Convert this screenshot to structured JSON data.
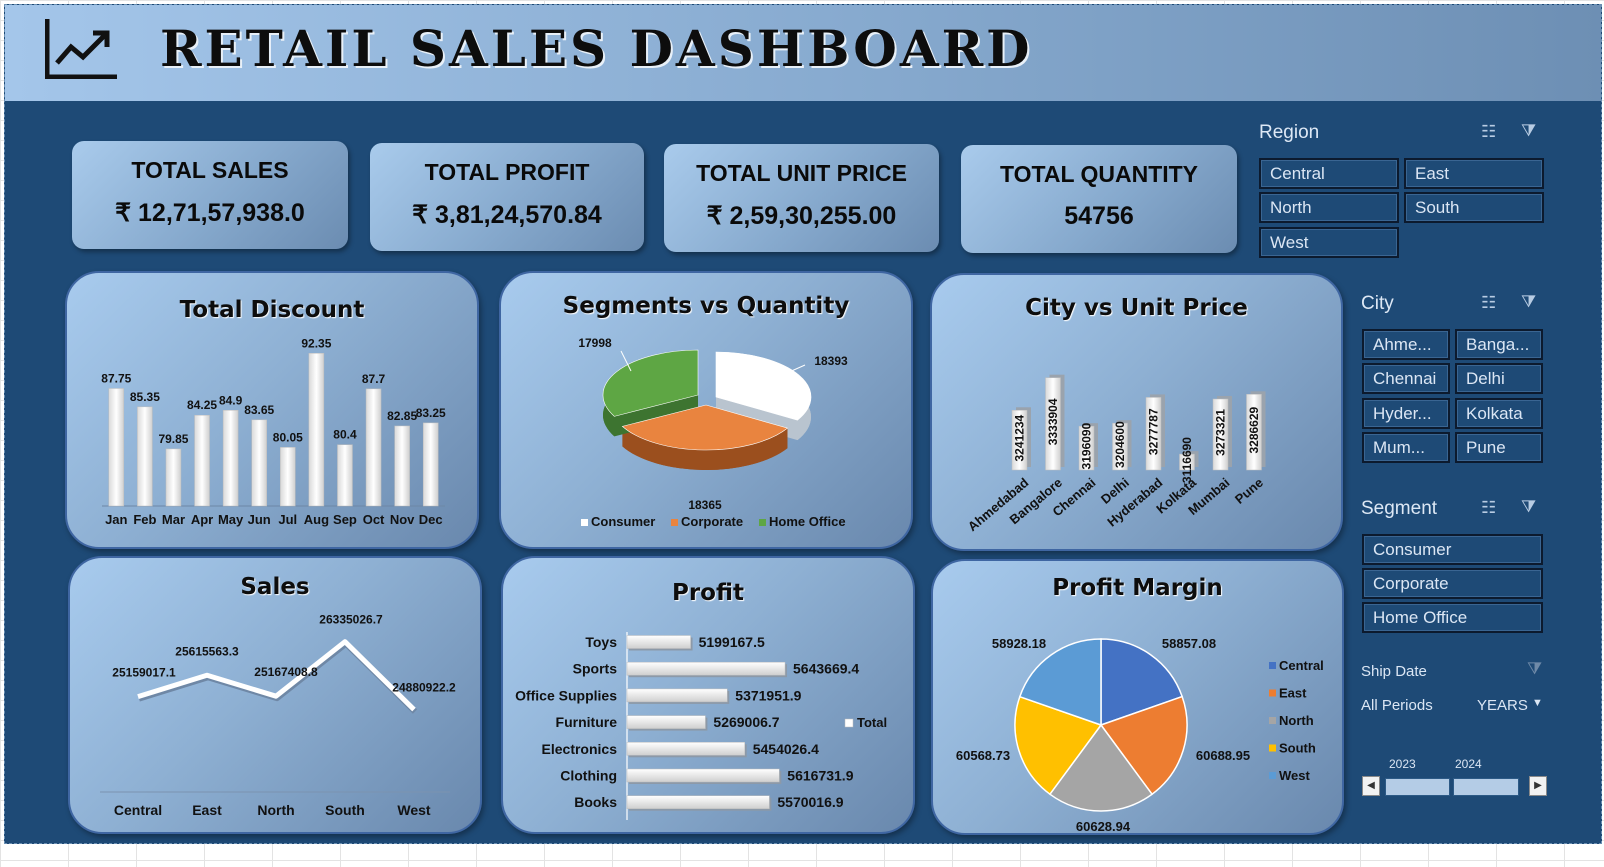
{
  "header": {
    "title": "RETAIL SALES DASHBOARD"
  },
  "kpis": [
    {
      "label": "TOTAL SALES",
      "value": "₹ 12,71,57,938.0"
    },
    {
      "label": "TOTAL PROFIT",
      "value": "₹ 3,81,24,570.84"
    },
    {
      "label": "TOTAL UNIT PRICE",
      "value": "₹ 2,59,30,255.00"
    },
    {
      "label": "TOTAL QUANTITY",
      "value": "54756"
    }
  ],
  "slicers": {
    "region": {
      "title": "Region",
      "items": [
        "Central",
        "East",
        "North",
        "South",
        "West"
      ]
    },
    "city": {
      "title": "City",
      "items": [
        "Ahme...",
        "Banga...",
        "Chennai",
        "Delhi",
        "Hyder...",
        "Kolkata",
        "Mum...",
        "Pune"
      ]
    },
    "segment": {
      "title": "Segment",
      "items": [
        "Consumer",
        "Corporate",
        "Home Office"
      ]
    },
    "timeline": {
      "title": "Ship Date",
      "period": "All Periods",
      "level": "YEARS",
      "years": [
        "2023",
        "2024"
      ]
    }
  },
  "colors": {
    "background": "#1e4a76",
    "accent": "#3f66a2",
    "pie_blue": "#4472c4",
    "pie_orange": "#ed7d31",
    "pie_gray": "#a5a5a5",
    "pie_yellow": "#ffc000",
    "pie_lightblue": "#5b9bd5"
  },
  "icons": [
    "chart-trend-icon",
    "multi-select-icon",
    "clear-filter-icon",
    "dropdown-arrow-icon",
    "scroll-left-icon",
    "scroll-right-icon"
  ],
  "chart_data": [
    {
      "type": "bar",
      "title": "Total Discount",
      "categories": [
        "Jan",
        "Feb",
        "Mar",
        "Apr",
        "May",
        "Jun",
        "Jul",
        "Aug",
        "Sep",
        "Oct",
        "Nov",
        "Dec"
      ],
      "values": [
        87.75,
        85.35,
        79.85,
        84.25,
        84.9,
        83.65,
        80.05,
        92.35,
        80.4,
        87.7,
        82.85,
        83.25
      ],
      "labels": [
        "87.75",
        "85.35",
        "79.85",
        "84.25",
        "84.9",
        "83.65",
        "80.05",
        "92.35",
        "80.4",
        "87.7",
        "82.85",
        "83.25"
      ],
      "ylim": [
        75,
        95
      ]
    },
    {
      "type": "pie",
      "title": "Segments vs Quantity",
      "categories": [
        "Consumer",
        "Corporate",
        "Home Office"
      ],
      "values": [
        18393,
        18365,
        17998
      ],
      "labels": [
        "18393",
        "18365",
        "17998"
      ],
      "colors": [
        "#ffffff",
        "#e9843f",
        "#5ea644"
      ]
    },
    {
      "type": "bar",
      "title": "City vs Unit Price",
      "categories": [
        "Ahmedabad",
        "Bangalore",
        "Chennai",
        "Delhi",
        "Hyderabad",
        "Kolkata",
        "Mumbai",
        "Pune"
      ],
      "values": [
        3241234,
        3333904,
        3196090,
        3204600,
        3277787,
        3116690,
        3273321,
        3286629
      ],
      "labels": [
        "3241234",
        "3333904",
        "3196090",
        "3204600",
        "3277787",
        "3116690",
        "3273321",
        "3286629"
      ],
      "ylim": [
        3100000,
        3350000
      ]
    },
    {
      "type": "line",
      "title": "Sales",
      "categories": [
        "Central",
        "East",
        "North",
        "South",
        "West"
      ],
      "values": [
        25159017.1,
        25615563.3,
        25167408.8,
        26335026.7,
        24880922.2
      ],
      "labels": [
        "25159017.1",
        "25615563.3",
        "25167408.8",
        "26335026.7",
        "24880922.2"
      ],
      "ylim": [
        24700000,
        26500000
      ]
    },
    {
      "type": "bar",
      "title": "Profit",
      "categories": [
        "Toys",
        "Sports",
        "Office Supplies",
        "Furniture",
        "Electronics",
        "Clothing",
        "Books"
      ],
      "values": [
        5199167.5,
        5643669.4,
        5371951.9,
        5269006.7,
        5454026.4,
        5616731.9,
        5570016.9
      ],
      "labels": [
        "5199167.5",
        "5643669.4",
        "5371951.9",
        "5269006.7",
        "5454026.4",
        "5616731.9",
        "5570016.9"
      ],
      "legend": "Total",
      "xlim": [
        4900000,
        5700000
      ]
    },
    {
      "type": "pie",
      "title": "Profit Margin",
      "categories": [
        "Central",
        "East",
        "North",
        "South",
        "West"
      ],
      "values": [
        58857.08,
        60688.95,
        60628.94,
        60568.73,
        58928.18
      ],
      "labels": [
        "58857.08",
        "60688.95",
        "60628.94",
        "60568.73",
        "58928.18"
      ],
      "colors": [
        "#4472c4",
        "#ed7d31",
        "#a5a5a5",
        "#ffc000",
        "#5b9bd5"
      ],
      "legend_position": "right"
    }
  ]
}
